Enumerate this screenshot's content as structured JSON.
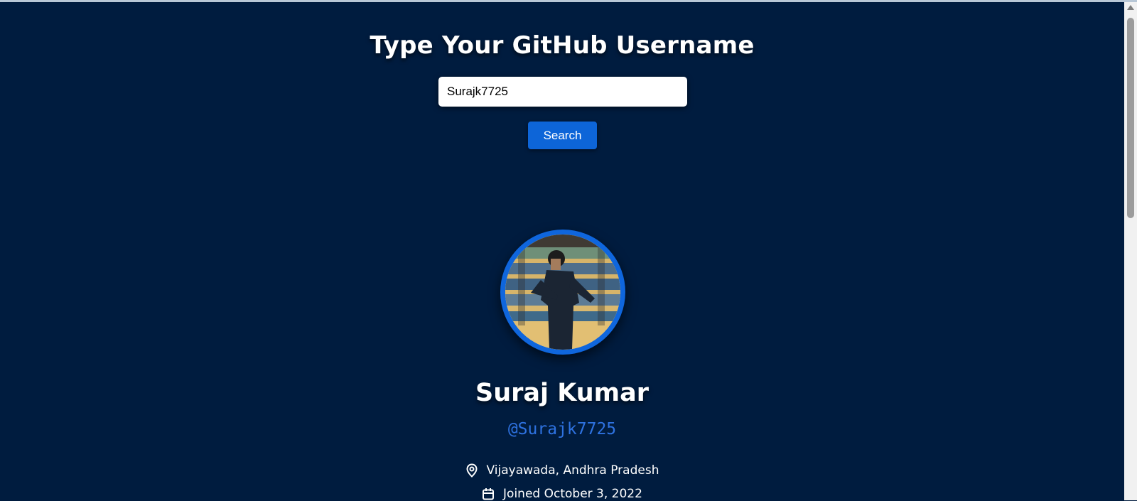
{
  "header": {
    "title": "Type Your GitHub Username"
  },
  "search": {
    "value": "Surajk7725",
    "button_label": "Search"
  },
  "profile": {
    "name": "Suraj Kumar",
    "handle": "@Surajk7725",
    "location": "Vijayawada, Andhra Pradesh",
    "joined": "Joined October 3, 2022",
    "location_icon": "map-pin-icon",
    "joined_icon": "calendar-icon"
  },
  "colors": {
    "background": "#001c3f",
    "accent": "#0d65d8",
    "handle": "#2e72e0"
  }
}
